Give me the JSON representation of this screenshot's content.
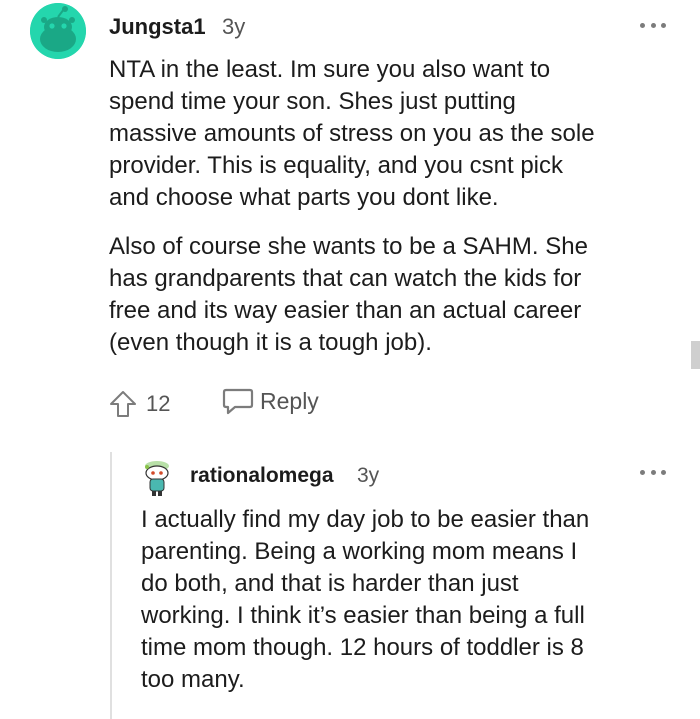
{
  "comment": {
    "username": "Jungsta1",
    "age": "3y",
    "paragraphs": [
      [
        "NTA in the least. Im sure you also want to",
        "spend time your son. Shes just putting",
        "massive amounts of stress on you as the sole",
        "provider. This is equality, and you csnt pick",
        "and choose what parts you dont like."
      ],
      [
        "Also of course she wants to be a SAHM. She",
        "has grandparents that can watch the kids for",
        "free and its way easier than an actual career",
        "(even though it is a tough job)."
      ]
    ],
    "votes": "12",
    "reply_label": "Reply"
  },
  "reply": {
    "username": "rationalomega",
    "age": "3y",
    "lines": [
      "I actually find my day job to be easier than",
      "parenting. Being a working mom means I",
      "do both, and that is harder than just",
      "working. I think it’s easier than being a full",
      "time mom though. 12 hours of toddler is 8",
      "too many."
    ]
  },
  "colors": {
    "avatar_bg": "#24d6ad",
    "text": "#1c1c1c",
    "meta": "#555555"
  },
  "icons": {
    "upvote": "upvote-arrow-icon",
    "reply": "speech-bubble-icon",
    "more": "more-options-icon"
  }
}
